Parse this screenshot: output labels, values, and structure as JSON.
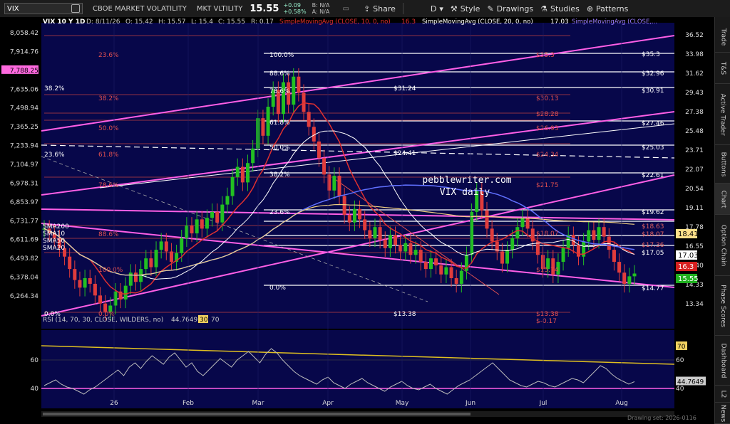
{
  "toolbar": {
    "symbol": "VIX",
    "name": "CBOE MARKET VOLATILITY",
    "short": "MKT VLTILITY",
    "last": "15.55",
    "change": "+0.09",
    "change_pct": "+0.58%",
    "bid": "B: N/A",
    "ask": "A: N/A",
    "share": "Share",
    "aggregation": "D",
    "style": "Style",
    "drawings": "Drawings",
    "studies": "Studies",
    "patterns": "Patterns"
  },
  "header": {
    "title": "VIX 10 Y 1D",
    "date": "D: 8/11/26",
    "open": "O: 15.42",
    "high": "H: 15.57",
    "low": "L: 15.4",
    "close": "C: 15.55",
    "range": "R: 0.17",
    "sma10": "SimpleMovingAvg (CLOSE, 10, 0, no)",
    "sma10_val": "16.3",
    "sma20": "SimpleMovingAvg (CLOSE, 20, 0, no)",
    "sma20_val": "17.03",
    "sma_other": "SimpleMovingAvg (CLOSE,..."
  },
  "watermark": {
    "line1": "pebblewriter.com",
    "line2": "VIX daily"
  },
  "rsi_header": {
    "label": "RSI (14, 70, 30, CLOSE, WILDERS, no)",
    "value": "44.7649",
    "low": "30",
    "high": "70"
  },
  "drawing_set": "Drawing set: 2026-0116",
  "chart_data": {
    "type": "candlestick",
    "right_axis": [
      "36.52",
      "33.98",
      "31.62",
      "29.43",
      "27.38",
      "25.48",
      "23.71",
      "22.07",
      "20.54",
      "19.11",
      "17.78",
      "16.55",
      "15.40",
      "14.33",
      "13.34"
    ],
    "left_axis": [
      "8,058.42",
      "7,914.76",
      "7,788.25",
      "7,635.06",
      "7,498.94",
      "7,365.25",
      "7,233.94",
      "7,104.97",
      "6,978.31",
      "6,853.97",
      "6,731.77",
      "6,611.69",
      "6,493.82",
      "6,378.04",
      "6,264.34"
    ],
    "left_highlight": "7,788.25",
    "months": [
      "26",
      "Feb",
      "Mar",
      "Apr",
      "May",
      "Jun",
      "Jul",
      "Aug"
    ],
    "rsi_axis": [
      "60",
      "40"
    ],
    "rsi_right": [
      "60",
      "40"
    ],
    "rsi_value_label": "44.7649",
    "rsi_70_label": "70",
    "price_tags": [
      {
        "text": "18.41",
        "bg": "#ffe08a",
        "fg": "#000"
      },
      {
        "text": "17.03",
        "bg": "#ffffff",
        "fg": "#000"
      },
      {
        "text": "16.3",
        "bg": "#d62020",
        "fg": "#fff"
      },
      {
        "text": "15.55",
        "bg": "#1fb01f",
        "fg": "#fff"
      }
    ],
    "level_labels": [
      "$35.3",
      "$32.96",
      "$30.91",
      "$27.46",
      "$25.03",
      "$22.61",
      "$19.62",
      "$18.63",
      "$18.07",
      "$17.36",
      "$17.05",
      "$14.77"
    ],
    "fib_left": [
      "38.2%",
      "23.6%",
      "0.0%"
    ],
    "fib_mid": [
      "100.0%",
      "88.6%",
      "78.6%",
      "61.8%",
      "50.0%",
      "38.2%",
      "23.6%",
      "0.0%"
    ],
    "fib_red": [
      "23.6%",
      "38.2%",
      "50.0%",
      "61.8%",
      "78.6%",
      "88.6%",
      "100.0%",
      "0.0%"
    ],
    "mid_values": [
      "$31.24",
      "$24.41",
      "$13.38"
    ],
    "red_values": [
      "$35.3",
      "$30.13",
      "$28.28",
      "$26.93",
      "$24.34",
      "$21.75",
      "$18.07",
      "$15.74",
      "$13.38",
      "$-0.17"
    ],
    "sma_labels": [
      "SMA200",
      "SMA10",
      "SMA50",
      "SMA20"
    ],
    "closes": [
      18.2,
      17.9,
      17.6,
      17.0,
      16.5,
      15.8,
      15.2,
      14.8,
      15.3,
      15.0,
      14.4,
      14.0,
      13.6,
      13.9,
      14.6,
      14.2,
      14.9,
      15.6,
      15.1,
      15.8,
      16.4,
      15.9,
      16.9,
      17.4,
      16.8,
      16.2,
      16.7,
      17.6,
      18.4,
      17.9,
      18.8,
      18.2,
      18.9,
      19.3,
      18.6,
      19.8,
      20.4,
      21.8,
      22.6,
      21.4,
      22.9,
      24.1,
      26.8,
      25.2,
      27.9,
      29.6,
      27.2,
      30.4,
      28.1,
      31.0,
      29.3,
      27.4,
      26.0,
      24.7,
      23.3,
      22.0,
      20.8,
      21.9,
      20.4,
      19.1,
      18.6,
      19.5,
      18.8,
      18.1,
      17.6,
      18.3,
      17.5,
      17.0,
      17.8,
      17.2,
      16.8,
      17.3,
      16.6,
      16.9,
      16.2,
      15.8,
      16.4,
      16.0,
      15.5,
      15.9,
      15.3,
      15.0,
      15.7,
      16.6,
      19.3,
      20.8,
      19.4,
      18.2,
      17.4,
      16.8,
      16.1,
      16.9,
      17.6,
      18.3,
      18.9,
      18.2,
      17.4,
      16.6,
      15.8,
      16.4,
      15.5,
      16.2,
      17.0,
      17.8,
      17.2,
      16.5,
      17.4,
      18.1,
      17.5,
      18.3,
      17.7,
      16.9,
      16.2,
      15.6,
      15.0,
      15.4,
      15.55
    ],
    "rsi": [
      42,
      44,
      46,
      43,
      41,
      40,
      38,
      36,
      39,
      41,
      44,
      47,
      50,
      53,
      49,
      55,
      58,
      54,
      59,
      63,
      60,
      57,
      62,
      65,
      60,
      55,
      58,
      52,
      49,
      53,
      57,
      61,
      58,
      55,
      60,
      63,
      66,
      62,
      58,
      64,
      68,
      65,
      60,
      56,
      52,
      49,
      47,
      45,
      43,
      46,
      48,
      44,
      42,
      40,
      43,
      45,
      47,
      44,
      42,
      40,
      38,
      41,
      43,
      45,
      42,
      40,
      39,
      41,
      43,
      40,
      38,
      36,
      39,
      42,
      44,
      46,
      49,
      52,
      55,
      58,
      54,
      50,
      46,
      44,
      42,
      41,
      43,
      45,
      44,
      42,
      41,
      43,
      45,
      47,
      46,
      44,
      48,
      52,
      56,
      54,
      50,
      47,
      45,
      43,
      44.76
    ]
  }
}
